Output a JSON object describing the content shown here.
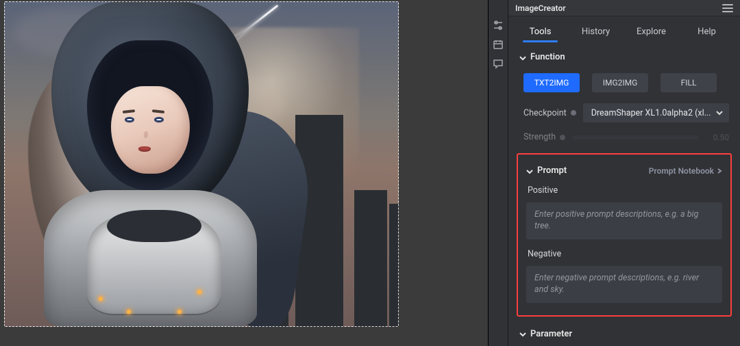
{
  "panel": {
    "title": "ImageCreator"
  },
  "tabs": {
    "items": [
      {
        "label": "Tools",
        "active": true
      },
      {
        "label": "History"
      },
      {
        "label": "Explore"
      },
      {
        "label": "Help"
      }
    ]
  },
  "function_section": {
    "header": "Function",
    "modes": [
      {
        "label": "TXT2IMG",
        "active": true
      },
      {
        "label": "IMG2IMG"
      },
      {
        "label": "FILL"
      }
    ],
    "checkpoint_label": "Checkpoint",
    "checkpoint_value": "DreamShaper XL1.0alpha2 (xl...",
    "strength_label": "Strength",
    "strength_value": "0.50"
  },
  "prompt_section": {
    "header": "Prompt",
    "notebook_link": "Prompt Notebook",
    "positive_label": "Positive",
    "positive_placeholder": "Enter positive prompt descriptions, e.g. a big tree.",
    "negative_label": "Negative",
    "negative_placeholder": "Enter negative prompt descriptions, e.g. river and sky."
  },
  "parameter_section": {
    "header": "Parameter"
  },
  "iconstrip": {
    "icon0": "slider-icon",
    "icon1": "calendar-icon",
    "icon2": "chat-icon"
  }
}
